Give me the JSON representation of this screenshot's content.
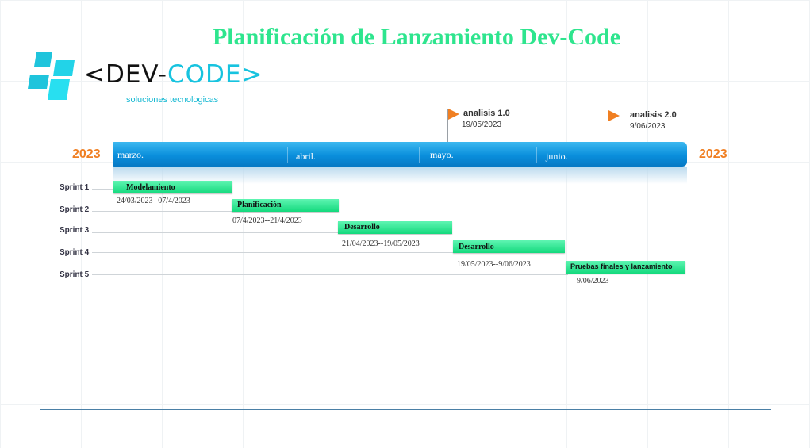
{
  "title": "Planificación de Lanzamiento Dev-Code",
  "logo": {
    "text_left": "<DEV-",
    "text_right": "CODE>",
    "subtitle": "soluciones tecnologicas"
  },
  "colors": {
    "title": "#2ee58e",
    "accent": "#17c3df",
    "year": "#f07f22",
    "bar": "#0a8fdc",
    "task": "#14d97d",
    "flag": "#f07f22"
  },
  "years": {
    "left": "2023",
    "right": "2023"
  },
  "months": [
    "marzo.",
    "abril.",
    "mayo.",
    "junio."
  ],
  "milestones": [
    {
      "name": "analisis 1.0",
      "date": "19/05/2023",
      "icon": "flag-icon"
    },
    {
      "name": "analisis 2.0",
      "date": "9/06/2023",
      "icon": "flag-icon"
    }
  ],
  "sprints": [
    "Sprint 1",
    "Sprint 2",
    "Sprint 3",
    "Sprint 4",
    "Sprint 5"
  ],
  "tasks": [
    {
      "label": "Modelamiento",
      "dates": "24/03/2023--07/4/2023"
    },
    {
      "label": "Planificación",
      "dates": "07/4/2023--21/4/2023"
    },
    {
      "label": "Desarrollo",
      "dates": "21/04/2023--19/05/2023"
    },
    {
      "label": "Desarrollo",
      "dates": "19/05/2023--9/06/2023"
    },
    {
      "label": "Pruebas finales y lanzamiento",
      "dates": "9/06/2023"
    }
  ]
}
